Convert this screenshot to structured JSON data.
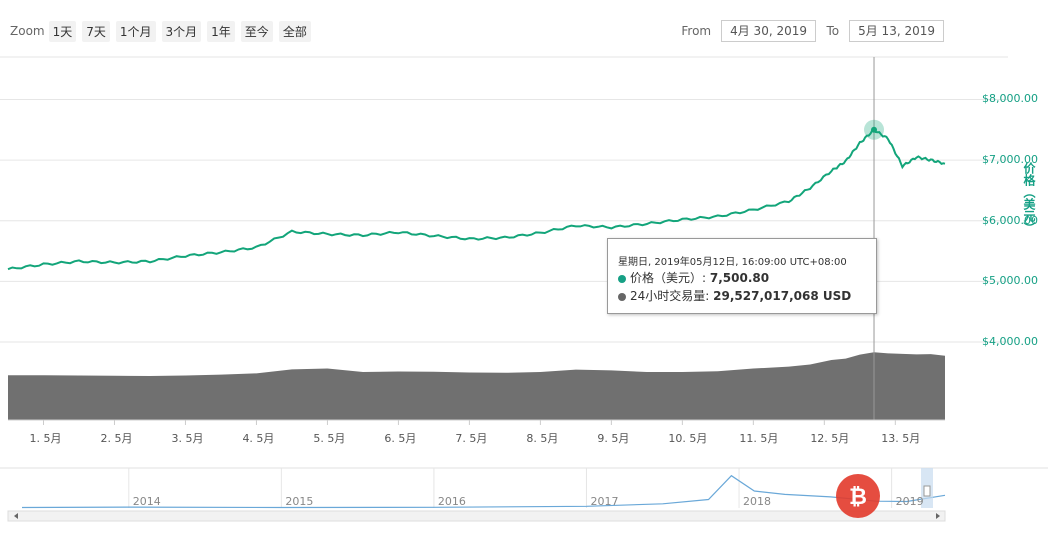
{
  "toolbar": {
    "zoom_label": "Zoom",
    "buttons": [
      "1天",
      "7天",
      "1个月",
      "3个月",
      "1年",
      "至今",
      "全部"
    ],
    "from_label": "From",
    "from_value": "4月 30, 2019",
    "to_label": "To",
    "to_value": "5月 13, 2019"
  },
  "tooltip": {
    "date": "星期日, 2019年05月12日, 16:09:00 UTC+08:00",
    "price_label": "价格（美元）:",
    "price_value": "7,500.80",
    "volume_label": "24小时交易量:",
    "volume_value": "29,527,017,068 USD",
    "price_color": "#16a085",
    "volume_color": "#666666"
  },
  "colors": {
    "price_line": "#13a57a",
    "volume_fill": "#707070",
    "navigator_line": "#6aa8d8",
    "watermark": "#e23a2b"
  },
  "chart_data": {
    "type": "line",
    "title": "",
    "ylabel": "价格（美元）",
    "ylim": [
      4000,
      8700
    ],
    "y_ticks": [
      "$4,000.00",
      "$5,000.00",
      "$6,000.00",
      "$7,000.00",
      "$8,000.00"
    ],
    "x_ticks": [
      "1. 5月",
      "2. 5月",
      "3. 5月",
      "4. 5月",
      "5. 5月",
      "6. 5月",
      "7. 5月",
      "8. 5月",
      "9. 5月",
      "10. 5月",
      "11. 5月",
      "12. 5月",
      "13. 5月"
    ],
    "series": [
      {
        "name": "价格（美元）",
        "x": [
          0,
          0.5,
          1,
          1.5,
          2,
          2.5,
          3,
          3.5,
          4,
          4.5,
          5,
          5.5,
          6,
          6.5,
          7,
          7.5,
          8,
          8.5,
          9,
          9.5,
          10,
          10.5,
          11,
          11.3,
          11.6,
          11.8,
          12,
          12.2,
          12.4,
          12.6,
          12.8,
          13,
          13.2
        ],
        "values": [
          5200,
          5280,
          5330,
          5310,
          5330,
          5420,
          5480,
          5560,
          5820,
          5780,
          5760,
          5810,
          5750,
          5700,
          5720,
          5800,
          5920,
          5890,
          5950,
          6020,
          6070,
          6180,
          6320,
          6540,
          6820,
          6980,
          7280,
          7500,
          7350,
          6900,
          7050,
          7000,
          6940
        ]
      },
      {
        "name": "24小时交易量",
        "x": [
          0,
          0.5,
          1,
          1.5,
          2,
          2.5,
          3,
          3.5,
          4,
          4.5,
          5,
          5.5,
          6,
          6.5,
          7,
          7.5,
          8,
          8.5,
          9,
          9.5,
          10,
          10.5,
          11,
          11.3,
          11.6,
          11.8,
          12,
          12.2,
          12.4,
          12.6,
          12.8,
          13,
          13.2
        ],
        "values": [
          16800000000,
          16800000000,
          16700000000,
          16600000000,
          16500000000,
          16700000000,
          17000000000,
          17500000000,
          19000000000,
          19300000000,
          18000000000,
          18200000000,
          18100000000,
          17800000000,
          17700000000,
          18000000000,
          18900000000,
          18600000000,
          18000000000,
          18000000000,
          18300000000,
          19300000000,
          20000000000,
          20800000000,
          22500000000,
          23000000000,
          24500000000,
          25400000000,
          25000000000,
          24800000000,
          24600000000,
          24700000000,
          24100000000
        ]
      }
    ],
    "highlight": {
      "x": 12.2,
      "value": 7500.8
    },
    "navigator": {
      "years": [
        "2014",
        "2015",
        "2016",
        "2017",
        "2018",
        "2019"
      ],
      "x": [
        2013.3,
        2014,
        2015,
        2016,
        2017,
        2017.5,
        2017.8,
        2017.95,
        2018.1,
        2018.3,
        2018.6,
        2018.9,
        2019.1,
        2019.35
      ],
      "values": [
        300,
        500,
        300,
        400,
        1000,
        2500,
        5000,
        19000,
        10000,
        8000,
        6500,
        4000,
        3800,
        7500
      ]
    }
  }
}
